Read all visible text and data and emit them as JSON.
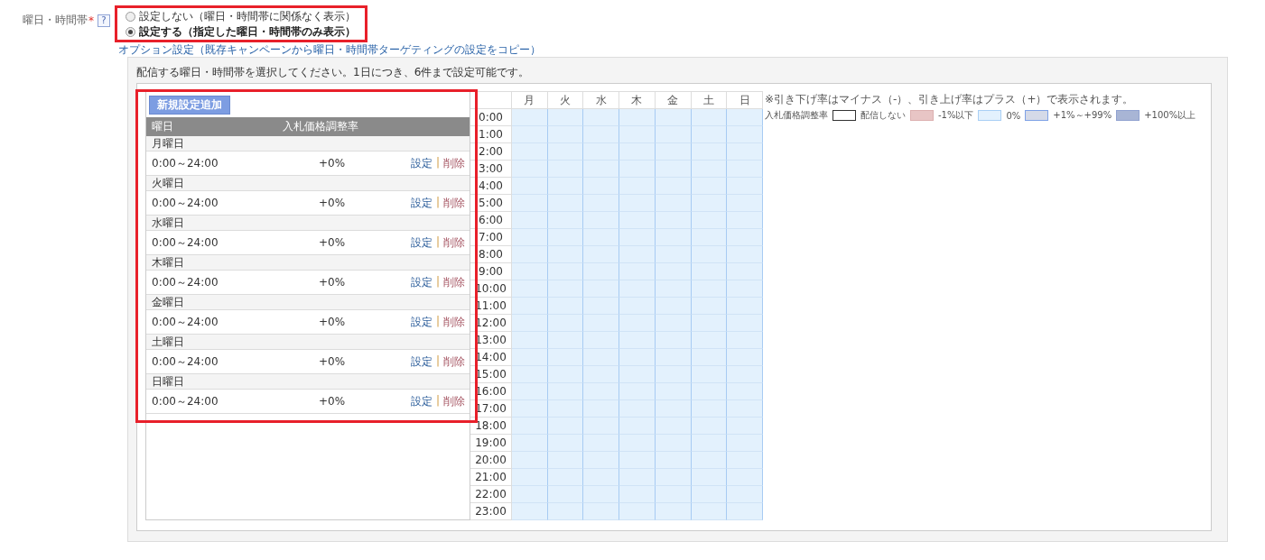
{
  "field": {
    "label": "曜日・時間帯",
    "required_mark": "*",
    "help": "?"
  },
  "targeting_options": {
    "highlighted": true,
    "options": [
      {
        "label": "設定しない（曜日・時間帯に関係なく表示）",
        "selected": false
      },
      {
        "label": "設定する（指定した曜日・時間帯のみ表示）",
        "selected": true
      }
    ]
  },
  "copy_link": "オプション設定（既存キャンペーンから曜日・時間帯ターゲティングの設定をコピー）",
  "instruction": "配信する曜日・時間帯を選択してください。1日につき、6件まで設定可能です。",
  "schedule_list": {
    "highlighted": true,
    "add_button": "新規設定追加",
    "columns": [
      "曜日",
      "入札価格調整率"
    ],
    "days": [
      {
        "day": "月曜日",
        "slots": [
          {
            "time": "0:00～24:00",
            "rate": "+0%",
            "edit": "設定",
            "separator": "|",
            "delete": "削除"
          }
        ]
      },
      {
        "day": "火曜日",
        "slots": [
          {
            "time": "0:00～24:00",
            "rate": "+0%",
            "edit": "設定",
            "separator": "|",
            "delete": "削除"
          }
        ]
      },
      {
        "day": "水曜日",
        "slots": [
          {
            "time": "0:00～24:00",
            "rate": "+0%",
            "edit": "設定",
            "separator": "|",
            "delete": "削除"
          }
        ]
      },
      {
        "day": "木曜日",
        "slots": [
          {
            "time": "0:00～24:00",
            "rate": "+0%",
            "edit": "設定",
            "separator": "|",
            "delete": "削除"
          }
        ]
      },
      {
        "day": "金曜日",
        "slots": [
          {
            "time": "0:00～24:00",
            "rate": "+0%",
            "edit": "設定",
            "separator": "|",
            "delete": "削除"
          }
        ]
      },
      {
        "day": "土曜日",
        "slots": [
          {
            "time": "0:00～24:00",
            "rate": "+0%",
            "edit": "設定",
            "separator": "|",
            "delete": "削除"
          }
        ]
      },
      {
        "day": "日曜日",
        "slots": [
          {
            "time": "0:00～24:00",
            "rate": "+0%",
            "edit": "設定",
            "separator": "|",
            "delete": "削除"
          }
        ]
      }
    ]
  },
  "grid": {
    "days": [
      "月",
      "火",
      "水",
      "木",
      "金",
      "土",
      "日"
    ],
    "hours": [
      {
        "time": "0:00",
        "cells": [
          {
            "kind": "zero"
          },
          {
            "kind": "zero"
          },
          {
            "kind": "zero"
          },
          {
            "kind": "zero"
          },
          {
            "kind": "zero"
          },
          {
            "kind": "zero"
          },
          {
            "kind": "zero"
          }
        ]
      },
      {
        "time": "1:00",
        "cells": [
          {
            "kind": "zero"
          },
          {
            "kind": "zero"
          },
          {
            "kind": "zero"
          },
          {
            "kind": "zero"
          },
          {
            "kind": "zero"
          },
          {
            "kind": "zero"
          },
          {
            "kind": "zero"
          }
        ]
      },
      {
        "time": "2:00",
        "cells": [
          {
            "kind": "zero"
          },
          {
            "kind": "zero"
          },
          {
            "kind": "zero"
          },
          {
            "kind": "zero"
          },
          {
            "kind": "zero"
          },
          {
            "kind": "zero"
          },
          {
            "kind": "zero"
          }
        ]
      },
      {
        "time": "3:00",
        "cells": [
          {
            "kind": "zero"
          },
          {
            "kind": "zero"
          },
          {
            "kind": "zero"
          },
          {
            "kind": "zero"
          },
          {
            "kind": "zero"
          },
          {
            "kind": "zero"
          },
          {
            "kind": "zero"
          }
        ]
      },
      {
        "time": "4:00",
        "cells": [
          {
            "kind": "zero"
          },
          {
            "kind": "zero"
          },
          {
            "kind": "zero"
          },
          {
            "kind": "zero"
          },
          {
            "kind": "zero"
          },
          {
            "kind": "zero"
          },
          {
            "kind": "zero"
          }
        ]
      },
      {
        "time": "5:00",
        "cells": [
          {
            "kind": "zero"
          },
          {
            "kind": "zero"
          },
          {
            "kind": "zero"
          },
          {
            "kind": "zero"
          },
          {
            "kind": "zero"
          },
          {
            "kind": "zero"
          },
          {
            "kind": "zero"
          }
        ]
      },
      {
        "time": "6:00",
        "cells": [
          {
            "kind": "zero"
          },
          {
            "kind": "zero"
          },
          {
            "kind": "zero"
          },
          {
            "kind": "zero"
          },
          {
            "kind": "zero"
          },
          {
            "kind": "zero"
          },
          {
            "kind": "zero"
          }
        ]
      },
      {
        "time": "7:00",
        "cells": [
          {
            "kind": "zero"
          },
          {
            "kind": "zero"
          },
          {
            "kind": "zero"
          },
          {
            "kind": "zero"
          },
          {
            "kind": "zero"
          },
          {
            "kind": "zero"
          },
          {
            "kind": "zero"
          }
        ]
      },
      {
        "time": "8:00",
        "cells": [
          {
            "kind": "zero"
          },
          {
            "kind": "zero"
          },
          {
            "kind": "zero"
          },
          {
            "kind": "zero"
          },
          {
            "kind": "zero"
          },
          {
            "kind": "zero"
          },
          {
            "kind": "zero"
          }
        ]
      },
      {
        "time": "9:00",
        "cells": [
          {
            "kind": "zero"
          },
          {
            "kind": "zero"
          },
          {
            "kind": "zero"
          },
          {
            "kind": "zero"
          },
          {
            "kind": "zero"
          },
          {
            "kind": "zero"
          },
          {
            "kind": "zero"
          }
        ]
      },
      {
        "time": "10:00",
        "cells": [
          {
            "kind": "zero"
          },
          {
            "kind": "zero"
          },
          {
            "kind": "zero"
          },
          {
            "kind": "zero"
          },
          {
            "kind": "zero"
          },
          {
            "kind": "zero"
          },
          {
            "kind": "zero"
          }
        ]
      },
      {
        "time": "11:00",
        "cells": [
          {
            "kind": "zero"
          },
          {
            "kind": "zero"
          },
          {
            "kind": "zero"
          },
          {
            "kind": "zero"
          },
          {
            "kind": "zero"
          },
          {
            "kind": "zero"
          },
          {
            "kind": "zero"
          }
        ]
      },
      {
        "time": "12:00",
        "cells": [
          {
            "kind": "zero"
          },
          {
            "kind": "zero"
          },
          {
            "kind": "zero"
          },
          {
            "kind": "zero"
          },
          {
            "kind": "zero"
          },
          {
            "kind": "zero"
          },
          {
            "kind": "zero"
          }
        ]
      },
      {
        "time": "13:00",
        "cells": [
          {
            "kind": "zero"
          },
          {
            "kind": "zero"
          },
          {
            "kind": "zero"
          },
          {
            "kind": "zero"
          },
          {
            "kind": "zero"
          },
          {
            "kind": "zero"
          },
          {
            "kind": "zero"
          }
        ]
      },
      {
        "time": "14:00",
        "cells": [
          {
            "kind": "zero"
          },
          {
            "kind": "zero"
          },
          {
            "kind": "zero"
          },
          {
            "kind": "zero"
          },
          {
            "kind": "zero"
          },
          {
            "kind": "zero"
          },
          {
            "kind": "zero"
          }
        ]
      },
      {
        "time": "15:00",
        "cells": [
          {
            "kind": "zero"
          },
          {
            "kind": "zero"
          },
          {
            "kind": "zero"
          },
          {
            "kind": "zero"
          },
          {
            "kind": "zero"
          },
          {
            "kind": "zero"
          },
          {
            "kind": "zero"
          }
        ]
      },
      {
        "time": "16:00",
        "cells": [
          {
            "kind": "zero"
          },
          {
            "kind": "zero"
          },
          {
            "kind": "zero"
          },
          {
            "kind": "zero"
          },
          {
            "kind": "zero"
          },
          {
            "kind": "zero"
          },
          {
            "kind": "zero"
          }
        ]
      },
      {
        "time": "17:00",
        "cells": [
          {
            "kind": "zero"
          },
          {
            "kind": "zero"
          },
          {
            "kind": "zero"
          },
          {
            "kind": "zero"
          },
          {
            "kind": "zero"
          },
          {
            "kind": "zero"
          },
          {
            "kind": "zero"
          }
        ]
      },
      {
        "time": "18:00",
        "cells": [
          {
            "kind": "zero"
          },
          {
            "kind": "zero"
          },
          {
            "kind": "zero"
          },
          {
            "kind": "zero"
          },
          {
            "kind": "zero"
          },
          {
            "kind": "zero"
          },
          {
            "kind": "zero"
          }
        ]
      },
      {
        "time": "19:00",
        "cells": [
          {
            "kind": "zero"
          },
          {
            "kind": "zero"
          },
          {
            "kind": "zero"
          },
          {
            "kind": "zero"
          },
          {
            "kind": "zero"
          },
          {
            "kind": "zero"
          },
          {
            "kind": "zero"
          }
        ]
      },
      {
        "time": "20:00",
        "cells": [
          {
            "kind": "zero"
          },
          {
            "kind": "zero"
          },
          {
            "kind": "zero"
          },
          {
            "kind": "zero"
          },
          {
            "kind": "zero"
          },
          {
            "kind": "zero"
          },
          {
            "kind": "zero"
          }
        ]
      },
      {
        "time": "21:00",
        "cells": [
          {
            "kind": "zero"
          },
          {
            "kind": "zero"
          },
          {
            "kind": "zero"
          },
          {
            "kind": "zero"
          },
          {
            "kind": "zero"
          },
          {
            "kind": "zero"
          },
          {
            "kind": "zero"
          }
        ]
      },
      {
        "time": "22:00",
        "cells": [
          {
            "kind": "zero"
          },
          {
            "kind": "zero"
          },
          {
            "kind": "zero"
          },
          {
            "kind": "zero"
          },
          {
            "kind": "zero"
          },
          {
            "kind": "zero"
          },
          {
            "kind": "zero"
          }
        ]
      },
      {
        "time": "23:00",
        "cells": [
          {
            "kind": "zero"
          },
          {
            "kind": "zero"
          },
          {
            "kind": "zero"
          },
          {
            "kind": "zero"
          },
          {
            "kind": "zero"
          },
          {
            "kind": "zero"
          },
          {
            "kind": "zero"
          }
        ]
      }
    ]
  },
  "legend": {
    "note": "※引き下げ率はマイナス（-）、引き上げ率はプラス（+）で表示されます。",
    "title": "入札価格調整率",
    "items": [
      {
        "kind": "none",
        "label": "配信しない",
        "color": "#ffffff"
      },
      {
        "kind": "minus",
        "label": "-1%以下",
        "color": "#e8c5c5"
      },
      {
        "kind": "zero",
        "label": "0%",
        "color": "#e3f1fd"
      },
      {
        "kind": "plus",
        "label": "+1%～+99%",
        "color": "#d5dae8"
      },
      {
        "kind": "max",
        "label": "+100%以上",
        "color": "#a8b5d5"
      }
    ]
  }
}
